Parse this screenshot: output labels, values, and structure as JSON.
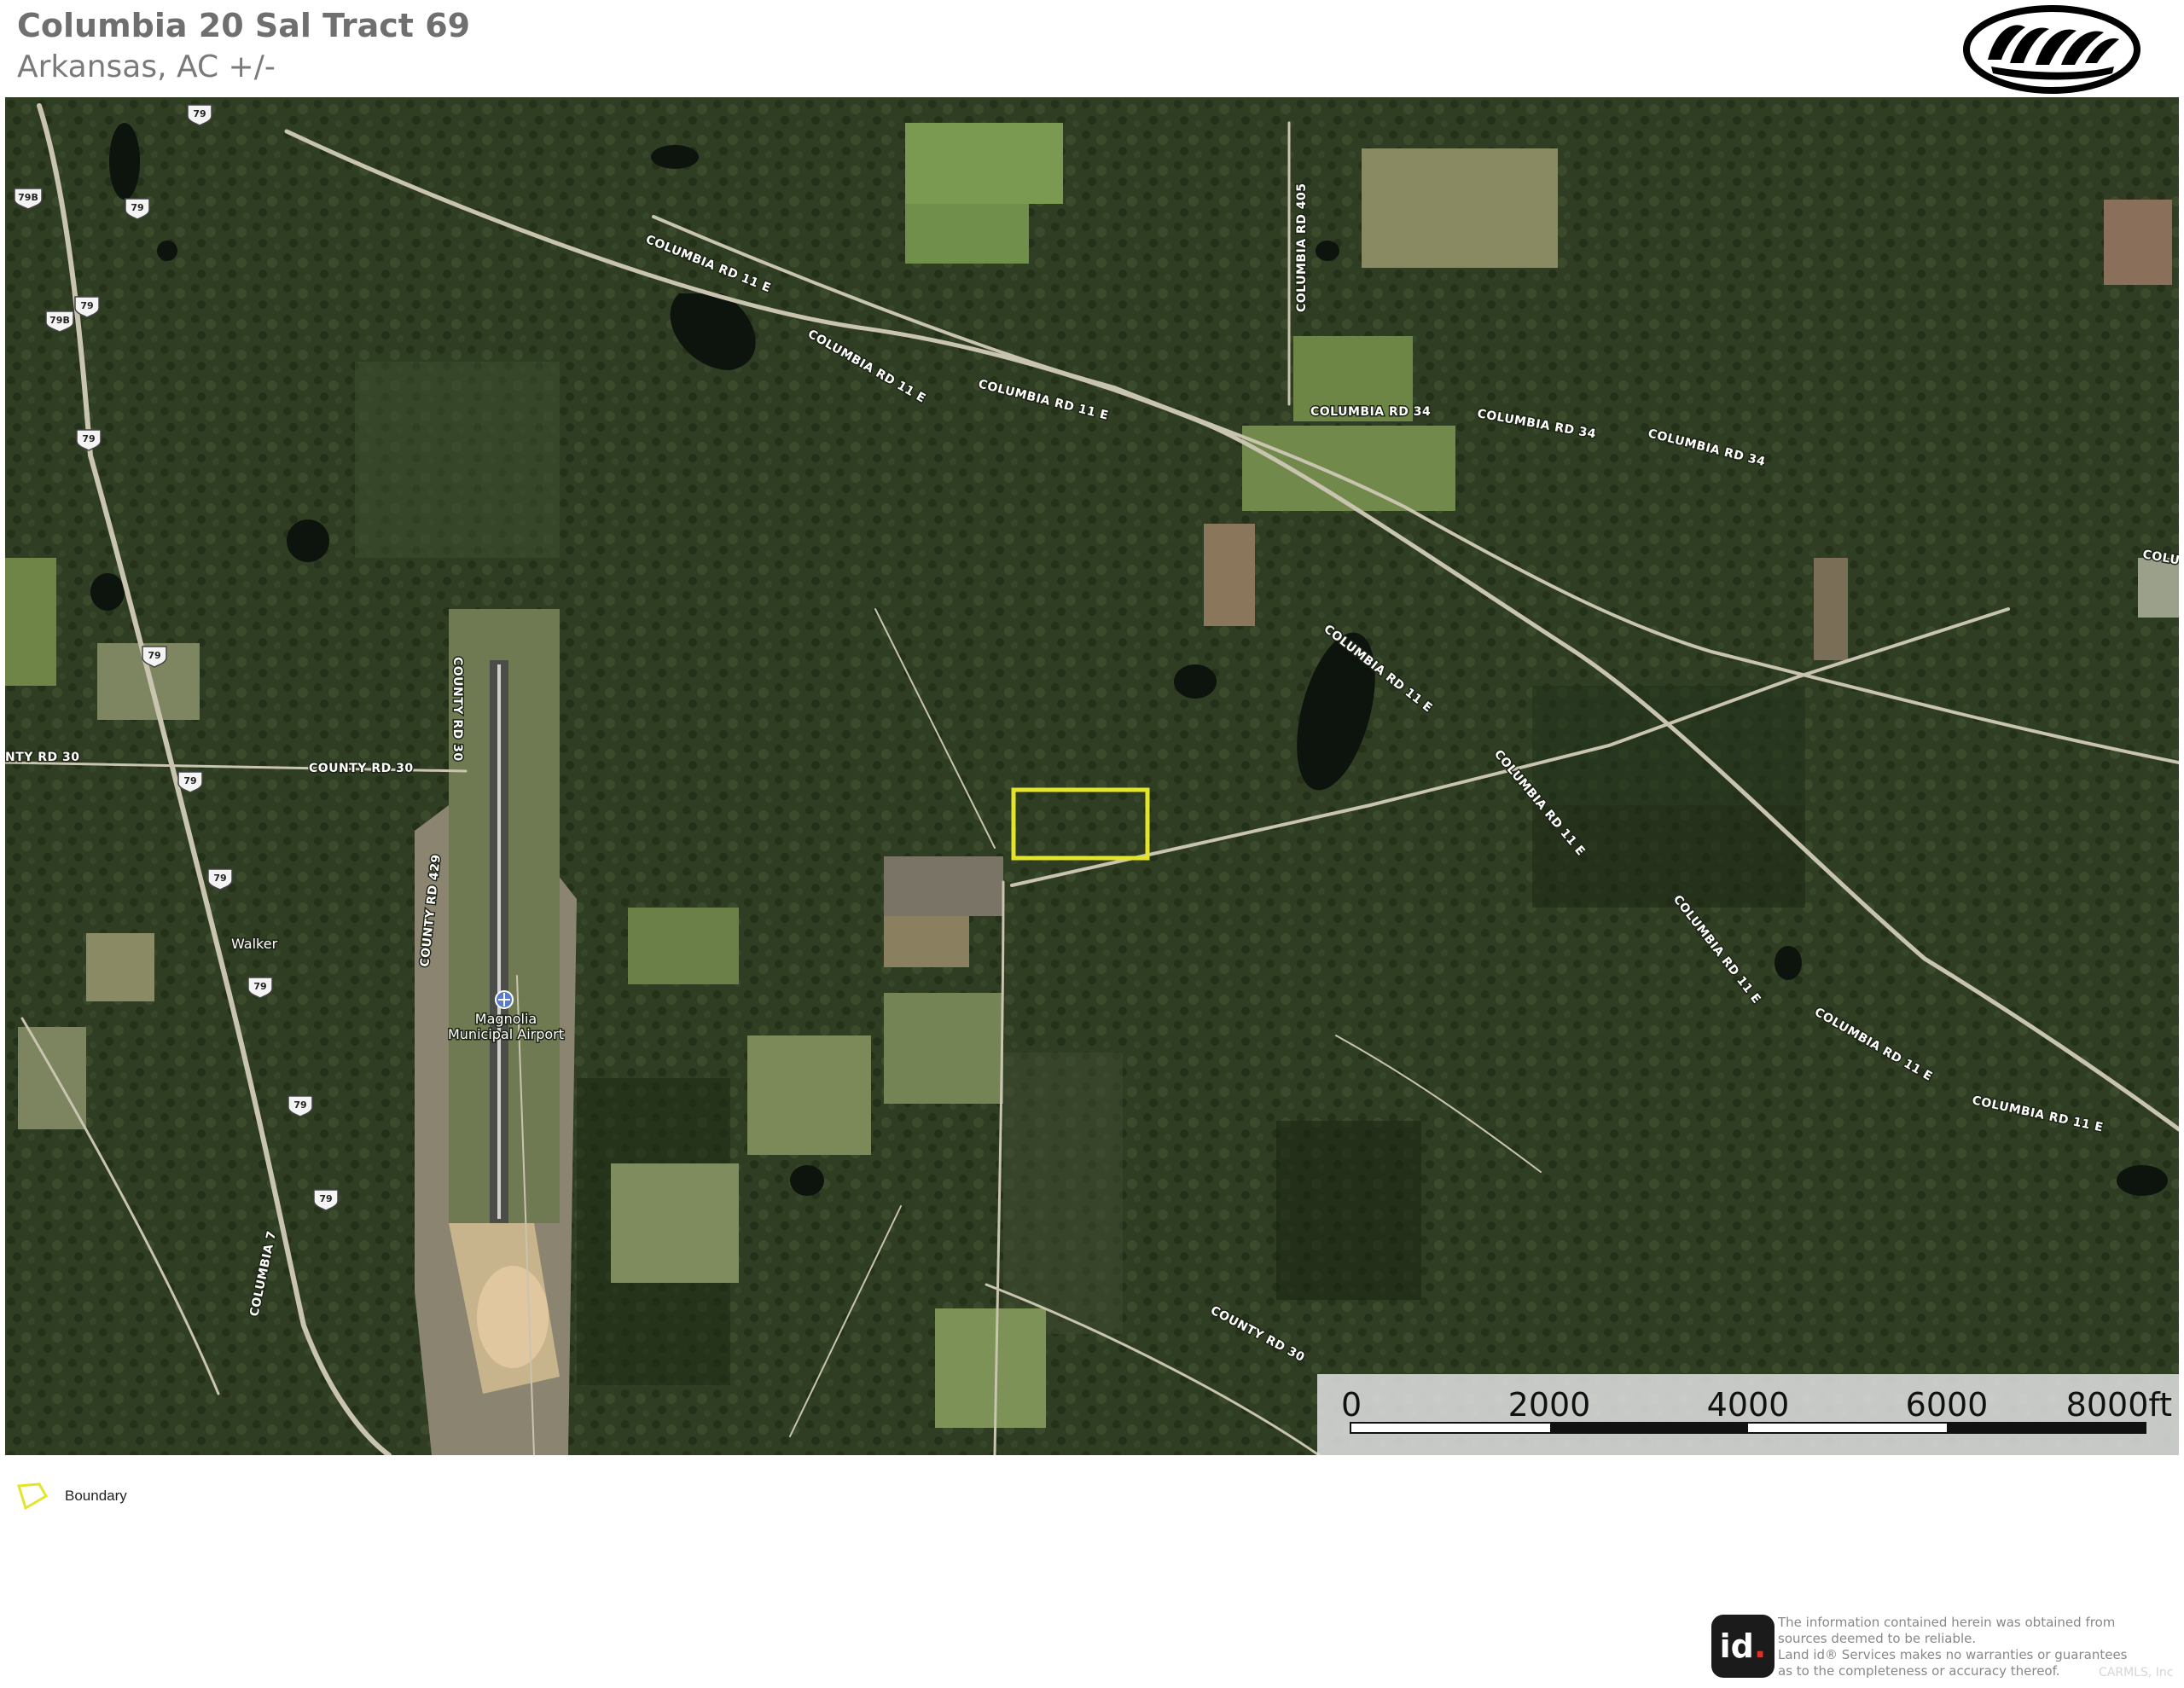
{
  "header": {
    "title": "Columbia 20 Sal Tract 69",
    "subtitle": "Arkansas,  AC +/-"
  },
  "logo": {
    "icon": "bear-paw-logo-icon"
  },
  "map": {
    "road_labels": {
      "columbia_rd_11e_a": "COLUMBIA RD 11 E",
      "columbia_rd_11e_b": "COLUMBIA RD 11 E",
      "columbia_rd_11e_c": "COLUMBIA RD 11 E",
      "columbia_rd_11e_d": "COLUMBIA RD 11 E",
      "columbia_rd_11e_e": "COLUMBIA RD 11 E",
      "columbia_rd_11e_f": "COLUMBIA RD 11 E",
      "columbia_rd_11e_g": "COLUMBIA RD 11 E",
      "columbia_rd_11e_h": "COLUMBIA RD 11 E",
      "columbia_rd_34_a": "COLUMBIA RD 34",
      "columbia_rd_34_b": "COLUMBIA RD 34",
      "columbia_rd_34_c": "COLUMBIA RD 34",
      "columbia_rd_405": "COLUMBIA RD 405",
      "colum_edge": "COLUM",
      "county_rd_30_a": "COUNTY RD 30",
      "county_rd_30_b": "COUNTY RD 30",
      "county_rd_30_c": "COUNTY RD 30",
      "county_rd_30_d": "NTY RD 30",
      "county_rd_429": "COUNTY RD 429",
      "columbia_7": "COLUMBIA 7"
    },
    "shields": [
      "79",
      "79",
      "79B",
      "79",
      "79",
      "79",
      "79",
      "79",
      "79",
      "79",
      "79",
      "79B"
    ],
    "places": {
      "walker": "Walker",
      "airport_line1": "Magnolia",
      "airport_line2": "Municipal Airport"
    },
    "scale_bar": {
      "labels": [
        "0",
        "2000",
        "4000",
        "6000",
        "8000ft"
      ]
    },
    "colors": {
      "boundary": "#e4e42a",
      "forest": "#2c3a21",
      "field": "#6f8a4a"
    }
  },
  "legend": {
    "items": [
      {
        "label": "Boundary",
        "icon": "boundary-polygon-icon"
      }
    ]
  },
  "footer": {
    "badge_text": "id",
    "badge_dot": ".",
    "disclaimer": [
      "The information contained herein was obtained from",
      "sources deemed to be reliable.",
      " Land id® Services makes no warranties or guarantees",
      "as to the completeness or accuracy thereof."
    ],
    "watermark": "CARMLS, Inc"
  }
}
